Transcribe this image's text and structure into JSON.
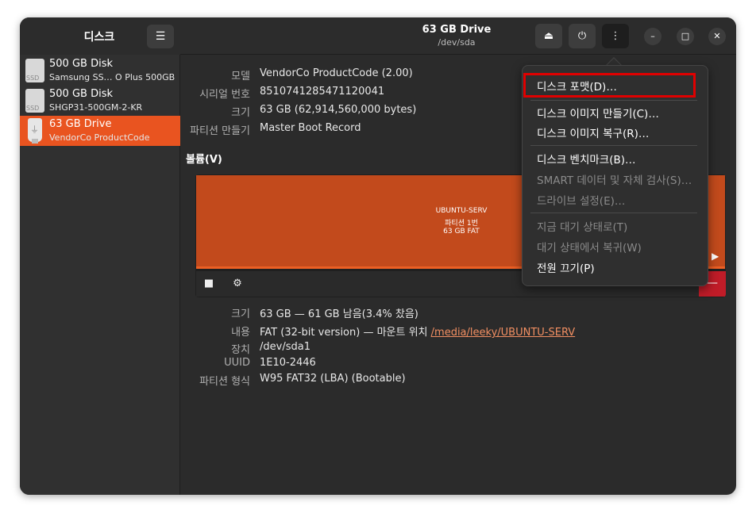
{
  "app": {
    "title": "디스크",
    "menu_icon": "hamburger-menu-icon"
  },
  "sidebar": {
    "items": [
      {
        "name": "500 GB Disk",
        "sub": "Samsung SS…  O Plus 500GB",
        "icon": "ssd-icon",
        "icon_text": "SSD",
        "selected": false
      },
      {
        "name": "500 GB Disk",
        "sub": "SHGP31-500GM-2-KR",
        "icon": "ssd-icon",
        "icon_text": "SSD",
        "selected": false
      },
      {
        "name": "63 GB Drive",
        "sub": "VendorCo ProductCode",
        "icon": "usb-drive-icon",
        "selected": true
      }
    ]
  },
  "header": {
    "title": "63 GB Drive",
    "subtitle": "/dev/sda",
    "buttons": [
      "eject-icon",
      "power-icon",
      "kebab-menu-icon"
    ],
    "window_controls": [
      "minimize-icon",
      "maximize-icon",
      "close-icon"
    ]
  },
  "drive": {
    "properties": [
      {
        "label": "모델",
        "value": "VendorCo ProductCode (2.00)"
      },
      {
        "label": "시리얼 번호",
        "value": "8510741285471120041"
      },
      {
        "label": "크기",
        "value": "63 GB (62,914,560,000 bytes)"
      },
      {
        "label": "파티션 만들기",
        "value": "Master Boot Record"
      }
    ]
  },
  "volumes": {
    "title": "볼륨(V)",
    "partition": {
      "name": "UBUNTU-SERV",
      "number": "파티션 1번",
      "size": "63 GB FAT"
    },
    "details": [
      {
        "label": "크기",
        "value": "63 GB — 61 GB 남음(3.4% 찼음)"
      },
      {
        "label": "내용",
        "value": "FAT (32-bit version) — 마운트 위치 ",
        "link": "/media/leeky/UBUNTU-SERV"
      },
      {
        "label": "장치",
        "value": "/dev/sda1"
      },
      {
        "label": "UUID",
        "value": "1E10-2446"
      },
      {
        "label": "파티션 형식",
        "value": "W95 FAT32 (LBA) (Bootable)"
      }
    ]
  },
  "popover_menu": {
    "items": [
      {
        "label": "디스크 포맷(D)…",
        "enabled": true,
        "highlighted": true
      },
      {
        "label": "디스크 이미지 만들기(C)…",
        "enabled": true
      },
      {
        "label": "디스크 이미지 복구(R)…",
        "enabled": true
      },
      {
        "label": "디스크 벤치마크(B)…",
        "enabled": true
      },
      {
        "label": "SMART 데이터 및 자체 검사(S)…",
        "enabled": false
      },
      {
        "label": "드라이브 설정(E)…",
        "enabled": false
      },
      {
        "label": "지금 대기 상태로(T)",
        "enabled": false
      },
      {
        "label": "대기 상태에서 복귀(W)",
        "enabled": false
      },
      {
        "label": "전원 끄기(P)",
        "enabled": true
      }
    ]
  },
  "colors": {
    "accent": "#e95420",
    "partition": "#c24a1c",
    "highlight_box": "#e00000",
    "delete_button": "#c01c28"
  }
}
